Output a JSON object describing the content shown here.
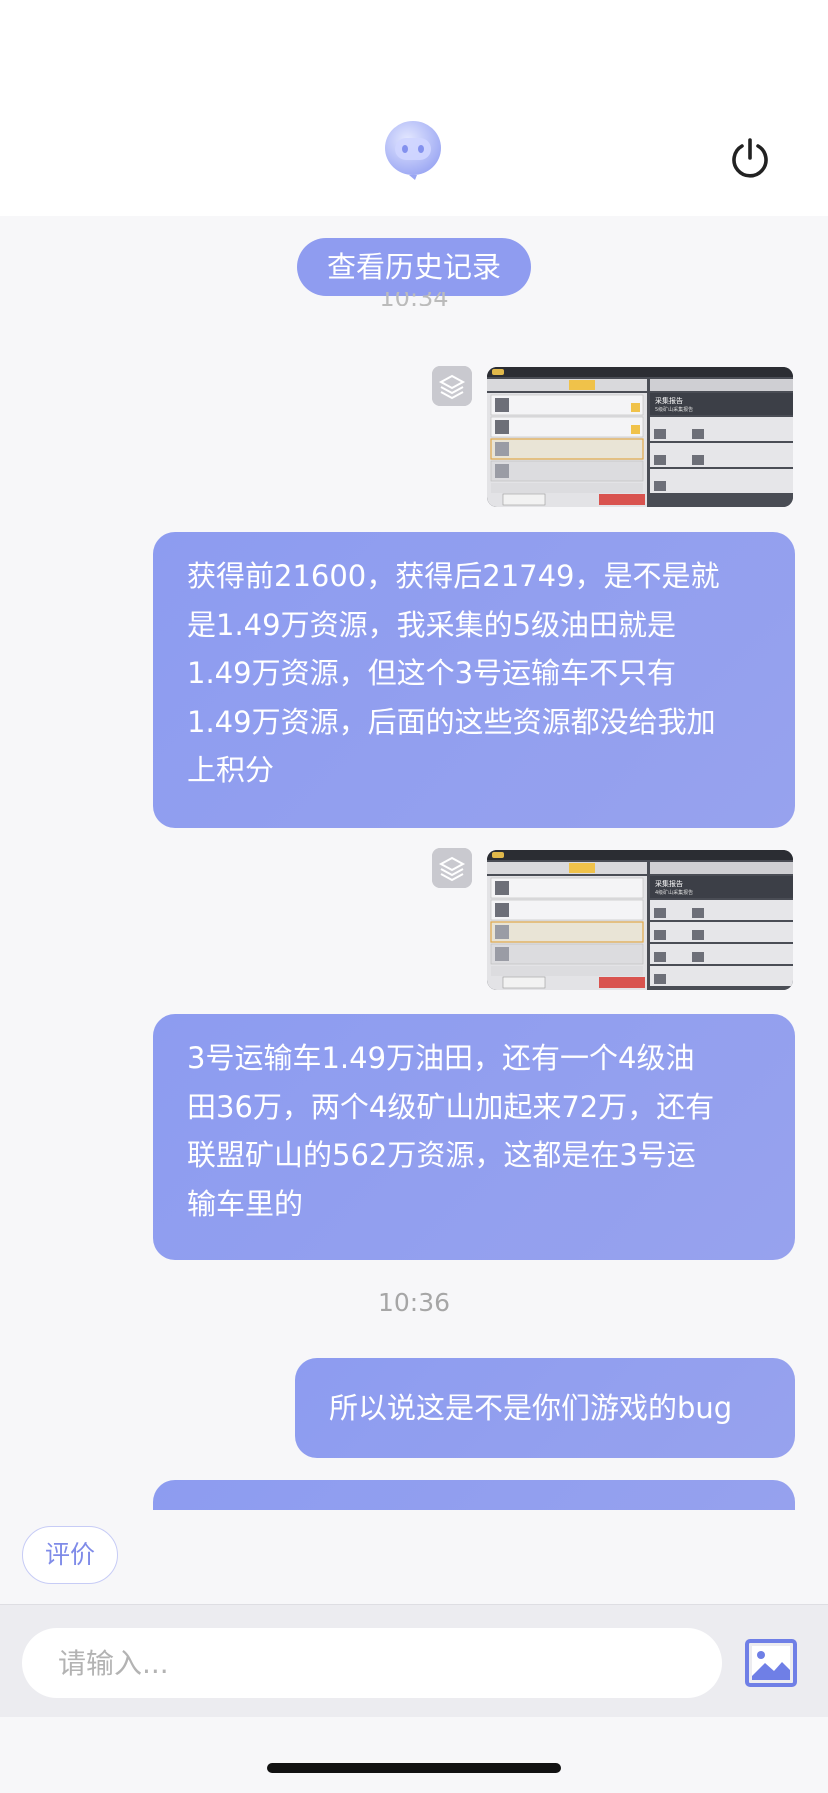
{
  "header": {
    "avatar_icon": "bot-avatar-icon",
    "power_icon": "power-icon"
  },
  "chat": {
    "history_button": "查看历史记录",
    "clipped_timestamp": "10:34",
    "messages": [
      {
        "type": "image",
        "icon": "layers-icon",
        "panel_title": "采集报告",
        "panel_subtitle": "5级矿山采集报告"
      },
      {
        "type": "text",
        "text": "获得前21600，获得后21749，是不是就\n是1.49万资源，我采集的5级油田就是\n1.49万资源，但这个3号运输车不只有\n1.49万资源，后面的这些资源都没给我加\n上积分"
      },
      {
        "type": "image",
        "icon": "layers-icon",
        "panel_title": "采集报告",
        "panel_subtitle": "4级矿山采集报告"
      },
      {
        "type": "text",
        "text": "3号运输车1.49万油田，还有一个4级油\n田36万，两个4级矿山加起来72万，还有\n联盟矿山的562万资源，这都是在3号运\n输车里的"
      }
    ],
    "timestamp": "10:36",
    "last_message": "所以说这是不是你们游戏的bug"
  },
  "rating_button": "评价",
  "input": {
    "placeholder": "请输入...",
    "image_icon": "image-upload-icon"
  },
  "colors": {
    "bubble": "#8f9cf0",
    "accent": "#7f8be8"
  }
}
